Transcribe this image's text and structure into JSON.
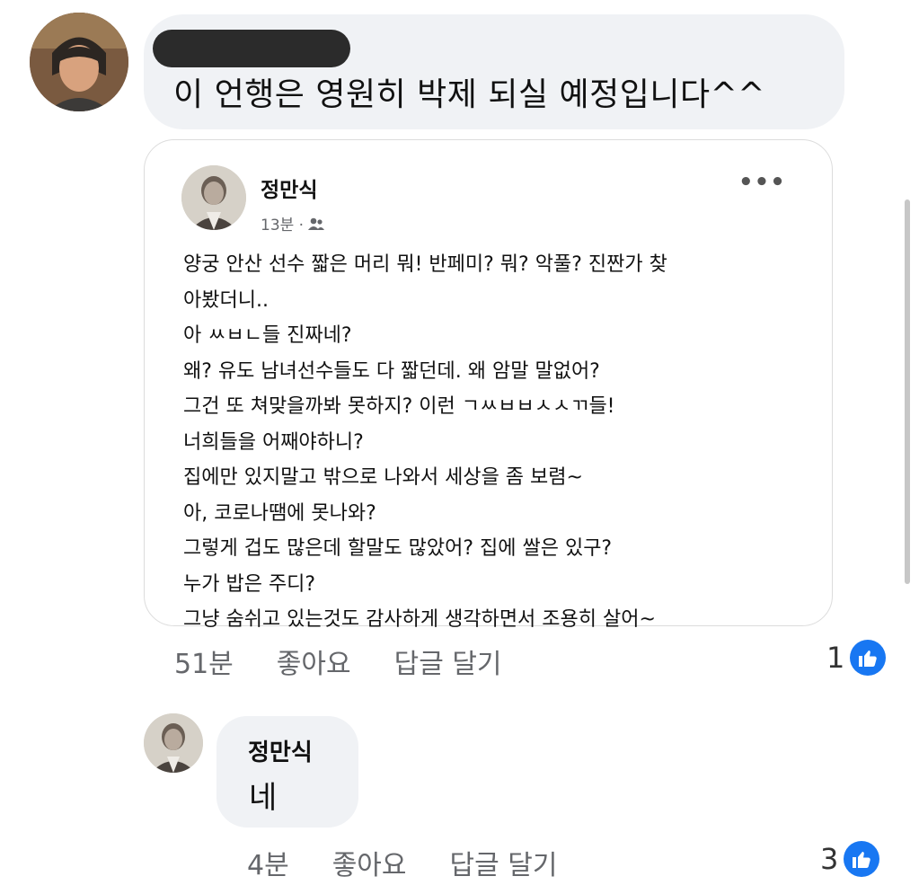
{
  "comment": {
    "text": "이 언행은 영원히 박제 되실 예정입니다^^",
    "time": "51분",
    "like_label": "좋아요",
    "reply_label": "답글 달기",
    "reaction_count": "1"
  },
  "shared_post": {
    "author": "정만식",
    "time": "13분 ·",
    "audience_icon": "friends-icon",
    "more_label": "•••",
    "lines": [
      "양궁 안산 선수 짧은 머리 뭐! 반페미? 뭐? 악풀? 진짠가 찾",
      "아봤더니..",
      "아 ㅆㅂㄴ들 진짜네?",
      "왜? 유도 남녀선수들도 다 짧던데. 왜 암말 말없어?",
      "그건 또 쳐맞을까봐 못하지? 이런 ㄱㅆㅂㅂㅅㅅㄲ들!",
      "너희들을 어째야하니?",
      "집에만 있지말고 밖으로 나와서 세상을 좀 보렴~",
      "아, 코로나땜에 못나와?",
      "그렇게 겁도 많은데 할말도 많았어? 집에 쌀은 있구?",
      "누가 밥은 주디?",
      "그냥 숨쉬고 있는것도 감사하게 생각하면서 조용히 살어~"
    ]
  },
  "reply": {
    "author": "정만식",
    "text": "네",
    "time": "4분",
    "like_label": "좋아요",
    "reply_label": "답글 달기",
    "reaction_count": "3"
  },
  "colors": {
    "bubble": "#f0f2f5",
    "like_blue": "#1877f2",
    "meta_gray": "#65676b"
  }
}
